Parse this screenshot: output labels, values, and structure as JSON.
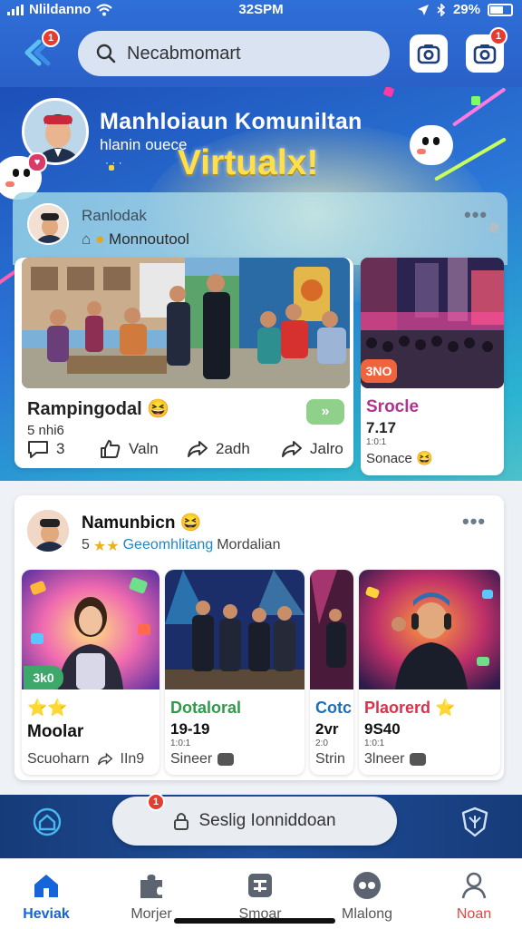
{
  "status_bar": {
    "carrier": "Nlildanno",
    "time": "32SPM",
    "battery": "29%"
  },
  "header": {
    "back_badge": "1",
    "search_placeholder": "Necabmomart",
    "camera_badge": "1"
  },
  "hero": {
    "title": "Manhloiaun Komuniltan",
    "subtitle": "hlanin ouece",
    "dots": "· · ·",
    "headline": "Virtualx!",
    "colors": {
      "headline": "#ffe04a",
      "accent_red": "#e73b2f"
    }
  },
  "featured_post": {
    "author": "Ranlodak",
    "subtitle": "Monnoutool",
    "main_title": "Rampingodal 😆",
    "main_meta": "5 nhi6",
    "actions": [
      {
        "icon": "comment-icon",
        "label": "3"
      },
      {
        "icon": "like-icon",
        "label": "Valn"
      },
      {
        "icon": "share-icon",
        "label": "2adh"
      },
      {
        "icon": "forward-icon",
        "label": "Jalro"
      }
    ],
    "side_tag": "3NO",
    "side_title": "Srocle",
    "side_count": "7.17",
    "side_small": "1:0:1",
    "side_footer": "Sonace 😆"
  },
  "community_post": {
    "author": "Namunbicn 😆",
    "rating_prefix": "5",
    "tag": "Geeomhlitang",
    "location": "Mordalian",
    "items": [
      {
        "tag": "3k0",
        "stars": "⭐⭐",
        "title": "Moolar",
        "footer": "Scuoharn",
        "footer_count": "IIn9"
      },
      {
        "title": "Dotaloral",
        "value": "19-19",
        "small": "1:0:1",
        "footer": "Sineer"
      },
      {
        "title": "Cotc",
        "value": "2vr",
        "small": "2:0",
        "footer": "Strin"
      },
      {
        "title": "Plaorerd ⭐",
        "value": "9S40",
        "small": "1:0:1",
        "footer": "3lneer"
      }
    ]
  },
  "floating_action": {
    "label": "Seslig Ionniddoan",
    "badge": "1"
  },
  "tabbar": {
    "items": [
      {
        "label": "Heviak",
        "icon": "home-icon",
        "active": true
      },
      {
        "label": "Morjer",
        "icon": "puzzle-icon"
      },
      {
        "label": "Smoar",
        "icon": "calendar-icon"
      },
      {
        "label": "Mlalong",
        "icon": "chat-bubble-icon"
      },
      {
        "label": "Noan",
        "icon": "profile-icon"
      }
    ],
    "colors": {
      "active": "#1565d8",
      "profile": "#e2483c"
    }
  }
}
